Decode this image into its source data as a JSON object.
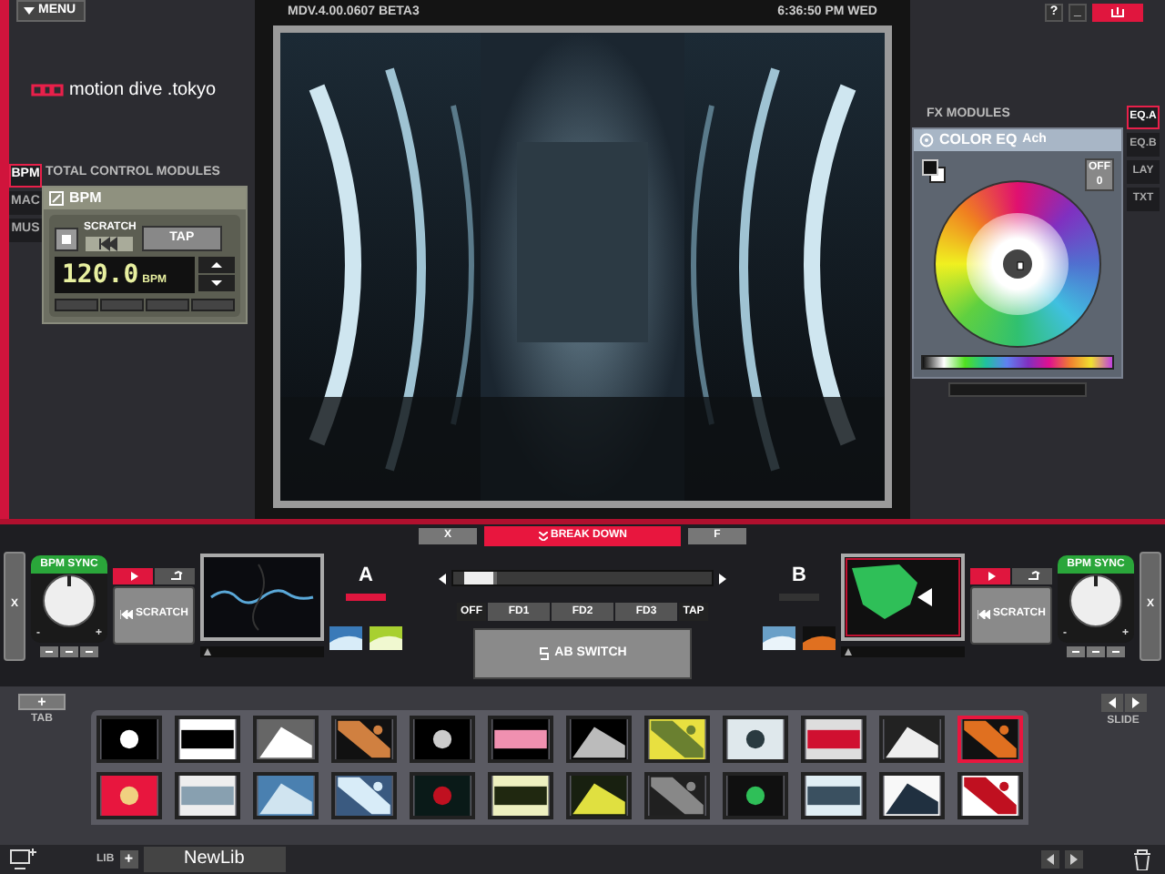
{
  "menu_button": "MENU",
  "logo": "motion dive .tokyo",
  "version": "MDV.4.00.0607 BETA3",
  "clock": "6:36:50 PM WED",
  "window_buttons": [
    "?",
    "_"
  ],
  "left_tabs": [
    {
      "label": "BPM",
      "selected": true
    },
    {
      "label": "MAC",
      "selected": false
    },
    {
      "label": "MUS",
      "selected": false
    }
  ],
  "total_control": {
    "title": "TOTAL CONTROL MODULES",
    "module_title": "BPM",
    "scratch_label": "SCRATCH",
    "tap_label": "TAP",
    "bpm_value": "120.0",
    "bpm_unit": "BPM"
  },
  "fx": {
    "title": "FX MODULES",
    "module_title": "COLOR EQ",
    "channel": "Ach",
    "off_label": "OFF",
    "off_value": "0"
  },
  "right_tabs": [
    {
      "label": "EQ.A",
      "selected": true
    },
    {
      "label": "EQ.B",
      "selected": false
    },
    {
      "label": "LAY",
      "selected": false
    },
    {
      "label": "TXT",
      "selected": false
    }
  ],
  "preview": {
    "kind": "picture"
  },
  "center": {
    "x_button": "X",
    "break_down": "BREAK DOWN",
    "f_button": "F",
    "crossfader": {
      "level": 0.05
    },
    "off_label": "OFF",
    "fader_buttons": [
      "FD1",
      "FD2",
      "FD3"
    ],
    "tap_label": "TAP",
    "ab_switch": "AB SWITCH"
  },
  "decks": [
    {
      "label": "A",
      "side_label": "X",
      "bpm_sync": "BPM SYNC",
      "scratch": "SCRATCH",
      "minus": "-",
      "plus": "+"
    },
    {
      "label": "B",
      "side_label": "X",
      "bpm_sync": "BPM SYNC",
      "scratch": "SCRATCH",
      "minus": "-",
      "plus": "+"
    }
  ],
  "library": {
    "tab_label": "TAB",
    "tab_add": "+",
    "slide_label": "SLIDE",
    "lib_label": "LIB",
    "lib_add": "+",
    "lib_name": "NewLib",
    "clips": [
      {
        "selected": false
      },
      {
        "selected": false
      },
      {
        "selected": false
      },
      {
        "selected": false
      },
      {
        "selected": false
      },
      {
        "selected": false
      },
      {
        "selected": false
      },
      {
        "selected": false
      },
      {
        "selected": false
      },
      {
        "selected": false
      },
      {
        "selected": false
      },
      {
        "selected": true
      },
      {
        "selected": false
      },
      {
        "selected": false
      },
      {
        "selected": false
      },
      {
        "selected": false
      },
      {
        "selected": false
      },
      {
        "selected": false
      },
      {
        "selected": false
      },
      {
        "selected": false
      },
      {
        "selected": false
      },
      {
        "selected": false
      },
      {
        "selected": false
      },
      {
        "selected": false
      }
    ]
  }
}
